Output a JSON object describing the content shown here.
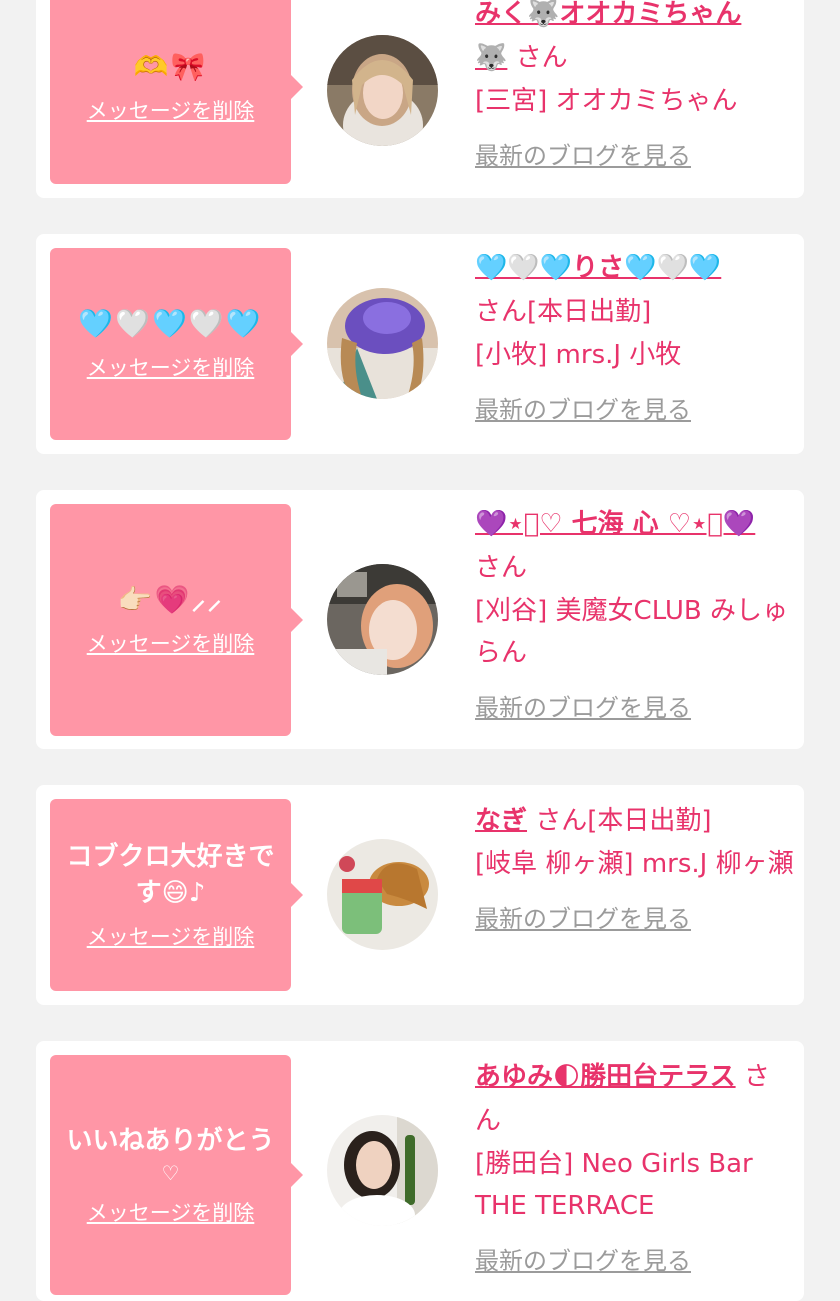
{
  "items": [
    {
      "message": "🫶🎀",
      "delete_label": "メッセージを削除",
      "name": "みく🐺オオカミちゃん",
      "name_extra": "🐺",
      "san": " さん",
      "status": "",
      "shop": "[三宮] オオカミちゃん",
      "blog_label": "最新のブログを見る"
    },
    {
      "message": "🩵🤍🩵🤍🩵",
      "delete_label": "メッセージを削除",
      "name": "🩵🤍🩵りさ🩵🤍🩵",
      "san": "さん",
      "status": "[本日出勤]",
      "shop": "[小牧] mrs.J 小牧",
      "blog_label": "最新のブログを見る"
    },
    {
      "message": "👉🏻💗⸝⸝",
      "delete_label": "メッセージを削除",
      "name": "💜⋆͛♡ 七海 心 ♡⋆͛💜",
      "san": "さん",
      "status": "",
      "shop": "[刈谷] 美魔女CLUB みしゅらん",
      "blog_label": "最新のブログを見る"
    },
    {
      "message": "コブクロ大好きです😄♪",
      "delete_label": "メッセージを削除",
      "name": "なぎ",
      "san": "  さん",
      "status": "[本日出勤]",
      "shop": "[岐阜 柳ヶ瀬] mrs.J 柳ヶ瀬",
      "blog_label": "最新のブログを見る"
    },
    {
      "message": "いいねありがとう",
      "message_sub": "♡",
      "delete_label": "メッセージを削除",
      "name": "あゆみ🌓勝田台テラス",
      "san": "  さん",
      "status": "",
      "shop": "[勝田台] Neo Girls Bar THE TERRACE",
      "blog_label": "最新のブログを見る"
    }
  ],
  "colors": {
    "bubble": "#ff96a6",
    "accent": "#e8336b",
    "link_gray": "#9b9b9b",
    "background": "#f2f2f2"
  }
}
